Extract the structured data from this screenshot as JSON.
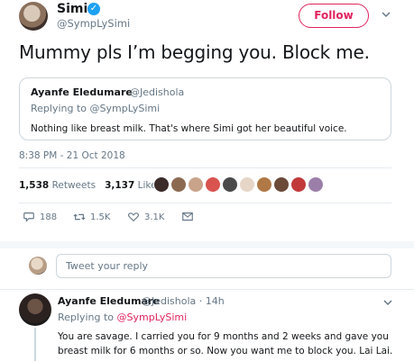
{
  "author": {
    "name": "Simi",
    "handle": "@SympLySimi"
  },
  "follow_label": "Follow",
  "tweet": {
    "text": "Mummy pls I’m begging you. Block me."
  },
  "quoted": {
    "name": "Ayanfe Eledumare",
    "handle": "@Jedishola",
    "replying_prefix": "Replying to ",
    "replying_handle": "@SympLySimi",
    "text": "Nothing like breast milk. That's where Simi got her beautiful voice."
  },
  "timestamp": "8:38 PM - 21 Oct 2018",
  "stats": {
    "retweets_count": "1,538",
    "retweets_label": "Retweets",
    "likes_count": "3,137",
    "likes_label": "Likes"
  },
  "actions": {
    "reply_count": "188",
    "retweet_count": "1.5K",
    "like_count": "3.1K"
  },
  "composer": {
    "placeholder": "Tweet your reply"
  },
  "reply": {
    "name": "Ayanfe Eledumare",
    "handle_time": "@Jedishola · 14h",
    "replying_prefix": "Replying to ",
    "replying_handle": "@SympLySimi",
    "text": "You are savage. I carried you for 9 months and 2 weeks and gave you breast milk for 6 months or so. Now you want me to block you. Lai Lai."
  },
  "colors": {
    "accent": "#e0245e",
    "muted": "#657786",
    "verified": "#1da1f2",
    "border": "#ccd6dd"
  },
  "icons": [
    "verified-icon",
    "chevron-down-icon",
    "reply-icon",
    "retweet-icon",
    "heart-icon",
    "message-icon"
  ]
}
